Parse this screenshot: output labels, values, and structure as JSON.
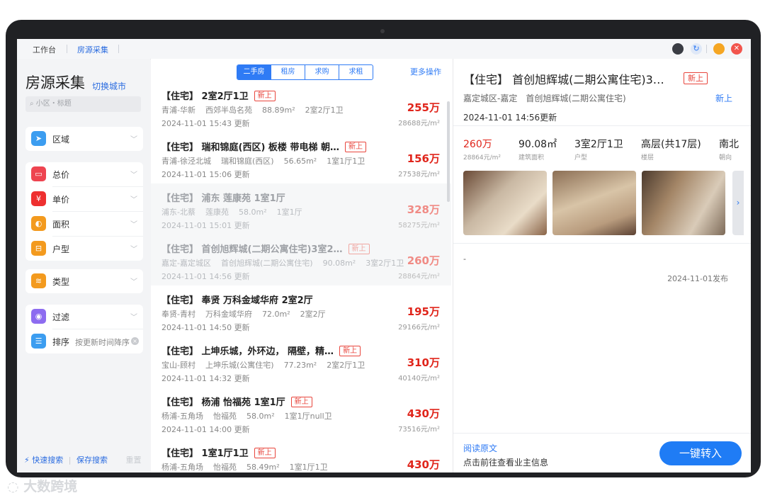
{
  "tabs": {
    "workbench": "工作台",
    "collect": "房源采集"
  },
  "sidebar": {
    "title": "房源采集",
    "switch_city": "切换城市",
    "search_placeholder": "小区・标题",
    "filters": {
      "area": "区域",
      "total_price": "总价",
      "unit_price": "单价",
      "size": "面积",
      "layout": "户型",
      "type": "类型",
      "filter": "过滤",
      "sort": "排序",
      "sort_value": "按更新时间降序"
    },
    "footer": {
      "quick_search": "快速搜索",
      "save_search": "保存搜索",
      "reset": "重置"
    }
  },
  "list": {
    "segments": [
      "二手房",
      "租房",
      "求购",
      "求租"
    ],
    "more_ops": "更多操作",
    "new_tag": "新上",
    "items": [
      {
        "title": "【住宅】 2室2厅1卫",
        "tag": true,
        "district": "青浦-华新",
        "community": "西郊半岛名苑",
        "area": "88.89m²",
        "layout": "2室2厅1卫",
        "date": "2024-11-01 15:43 更新",
        "price": "255万",
        "unit": "28688元/m²",
        "dim": false
      },
      {
        "title": "【住宅】 瑞和锦庭(西区) 板楼 带电梯 朝…",
        "tag": true,
        "district": "青浦-徐泾北城",
        "community": "瑞和锦庭(西区)",
        "area": "56.65m²",
        "layout": "1室1厅1卫",
        "date": "2024-11-01 15:06 更新",
        "price": "156万",
        "unit": "27538元/m²",
        "dim": false
      },
      {
        "title": "【住宅】 浦东 莲康苑 1室1厅",
        "tag": false,
        "district": "浦东-北蔡",
        "community": "莲康苑",
        "area": "58.0m²",
        "layout": "1室1厅",
        "date": "2024-11-01 15:01 更新",
        "price": "328万",
        "unit": "58275元/m²",
        "dim": true
      },
      {
        "title": "【住宅】 首创旭辉城(二期公寓住宅)3室2…",
        "tag": true,
        "district": "嘉定-嘉定城区",
        "community": "首创旭辉城(二期公寓住宅)",
        "area": "90.08m²",
        "layout": "3室2厅1卫",
        "date": "2024-11-01 14:56 更新",
        "price": "260万",
        "unit": "28864元/m²",
        "dim": true
      },
      {
        "title": "【住宅】 奉贤 万科金域华府 2室2厅",
        "tag": false,
        "district": "奉贤-青村",
        "community": "万科金域华府",
        "area": "72.0m²",
        "layout": "2室2厅",
        "date": "2024-11-01 14:50 更新",
        "price": "195万",
        "unit": "29166元/m²",
        "dim": false
      },
      {
        "title": "【住宅】 上坤乐城，外环边， 隔壁，精…",
        "tag": true,
        "district": "宝山-顾村",
        "community": "上坤乐城(公寓住宅)",
        "area": "77.23m²",
        "layout": "2室2厅1卫",
        "date": "2024-11-01 14:32 更新",
        "price": "310万",
        "unit": "40140元/m²",
        "dim": false
      },
      {
        "title": "【住宅】 杨浦 怡福苑 1室1厅",
        "tag": true,
        "district": "杨浦-五角场",
        "community": "怡福苑",
        "area": "58.0m²",
        "layout": "1室1厅null卫",
        "date": "2024-11-01 14:00 更新",
        "price": "430万",
        "unit": "73516元/m²",
        "dim": false
      },
      {
        "title": "【住宅】 1室1厅1卫",
        "tag": true,
        "district": "杨浦-五角场",
        "community": "怡福苑",
        "area": "58.49m²",
        "layout": "1室1厅1卫",
        "date": "",
        "price": "430万",
        "unit": "",
        "dim": false
      }
    ]
  },
  "detail": {
    "title": "【住宅】 首创旭辉城(二期公寓住宅)3…",
    "tag": "新上",
    "address": "嘉定城区-嘉定　首创旭辉城(二期公寓住宅)",
    "new": "新上",
    "updated": "2024-11-01 14:56更新",
    "stats": [
      {
        "v": "260万",
        "k": "28864元/m²",
        "red": true
      },
      {
        "v": "90.08㎡",
        "k": "建筑面积"
      },
      {
        "v": "3室2厅1卫",
        "k": "户型"
      },
      {
        "v": "高层(共17层)",
        "k": "楼层"
      },
      {
        "v": "南北",
        "k": "朝向"
      }
    ],
    "dash": "-",
    "published": "2024-11-01发布",
    "read_original": "阅读原文",
    "hint": "点击前往查看业主信息",
    "transfer_btn": "一键转入"
  },
  "watermark": "大数跨境"
}
